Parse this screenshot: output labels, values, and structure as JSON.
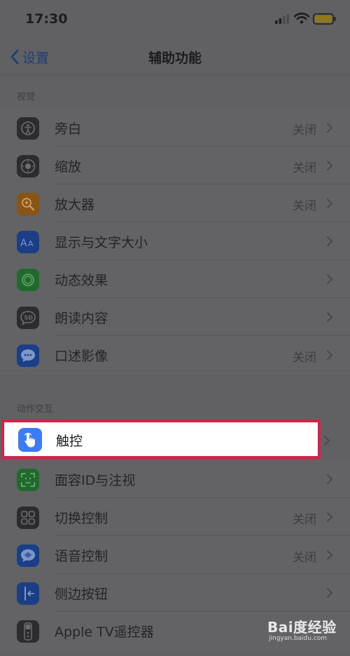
{
  "status_bar": {
    "time": "17:30"
  },
  "nav": {
    "back_label": "设置",
    "title": "辅助功能"
  },
  "sections": [
    {
      "header": "视觉",
      "items": [
        {
          "label": "旁白",
          "value": "关闭",
          "icon": "voiceover-icon",
          "icon_color": "#2c2c2e"
        },
        {
          "label": "缩放",
          "value": "关闭",
          "icon": "zoom-icon",
          "icon_color": "#2c2c2e"
        },
        {
          "label": "放大器",
          "value": "关闭",
          "icon": "magnifier-icon",
          "icon_color": "#8a5414"
        },
        {
          "label": "显示与文字大小",
          "value": "",
          "icon": "text-size-icon",
          "icon_color": "#1b3f86"
        },
        {
          "label": "动态效果",
          "value": "",
          "icon": "motion-icon",
          "icon_color": "#1f6a2c"
        },
        {
          "label": "朗读内容",
          "value": "",
          "icon": "spoken-content-icon",
          "icon_color": "#2c2c2e"
        },
        {
          "label": "口述影像",
          "value": "关闭",
          "icon": "audio-description-icon",
          "icon_color": "#1b3f86"
        }
      ]
    },
    {
      "header": "动作交互",
      "items": [
        {
          "label": "触控",
          "value": "",
          "icon": "touch-hand-icon",
          "icon_color": "#3c7bf6",
          "highlighted": true
        },
        {
          "label": "面容ID与注视",
          "value": "",
          "icon": "face-id-icon",
          "icon_color": "#1f6a2c"
        },
        {
          "label": "切换控制",
          "value": "关闭",
          "icon": "switch-control-icon",
          "icon_color": "#2c2c2e"
        },
        {
          "label": "语音控制",
          "value": "关闭",
          "icon": "voice-control-icon",
          "icon_color": "#1b3f86"
        },
        {
          "label": "侧边按钮",
          "value": "",
          "icon": "side-button-icon",
          "icon_color": "#1b3f86"
        },
        {
          "label": "Apple TV遥控器",
          "value": "",
          "icon": "apple-tv-remote-icon",
          "icon_color": "#2c2c2e"
        }
      ]
    }
  ],
  "watermark": {
    "brand": "Bai度经验",
    "url": "jingyan.baidu.com"
  },
  "colors": {
    "overlay": "#616164",
    "highlight_border": "#d0244e",
    "accent": "#3c7bf6"
  }
}
